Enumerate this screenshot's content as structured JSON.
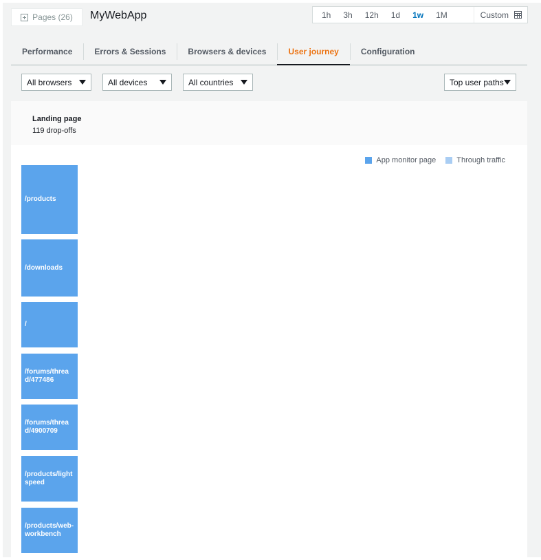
{
  "header": {
    "pages_button": {
      "label": "Pages (26)",
      "icon": "plus-box-icon"
    },
    "app_title": "MyWebApp",
    "time_range": {
      "options": [
        "1h",
        "3h",
        "12h",
        "1d",
        "1w",
        "1M"
      ],
      "selected": "1w",
      "custom_label": "Custom",
      "custom_icon": "calendar-icon"
    }
  },
  "tabs": [
    {
      "label": "Performance",
      "active": false
    },
    {
      "label": "Errors & Sessions",
      "active": false
    },
    {
      "label": "Browsers & devices",
      "active": false
    },
    {
      "label": "User journey",
      "active": true
    },
    {
      "label": "Configuration",
      "active": false
    }
  ],
  "filters": {
    "browsers": "All browsers",
    "devices": "All devices",
    "countries": "All countries",
    "view": "Top user paths"
  },
  "landing": {
    "title": "Landing page",
    "dropoffs": "119 drop-offs"
  },
  "legend": [
    {
      "label": "App monitor page",
      "color": "#5ba4ec"
    },
    {
      "label": "Through traffic",
      "color": "#a9cdf3"
    }
  ],
  "nodes": [
    {
      "label": "/products"
    },
    {
      "label": "/downloads"
    },
    {
      "label": "/"
    },
    {
      "label": "/forums/thread/477486"
    },
    {
      "label": "/forums/thread/4900709"
    },
    {
      "label": "/products/lightspeed"
    },
    {
      "label": "/products/web-workbench"
    }
  ],
  "colors": {
    "accent_active_tab": "#ec7211",
    "selected_time": "#0073bb",
    "node_fill": "#5ba4ec"
  }
}
